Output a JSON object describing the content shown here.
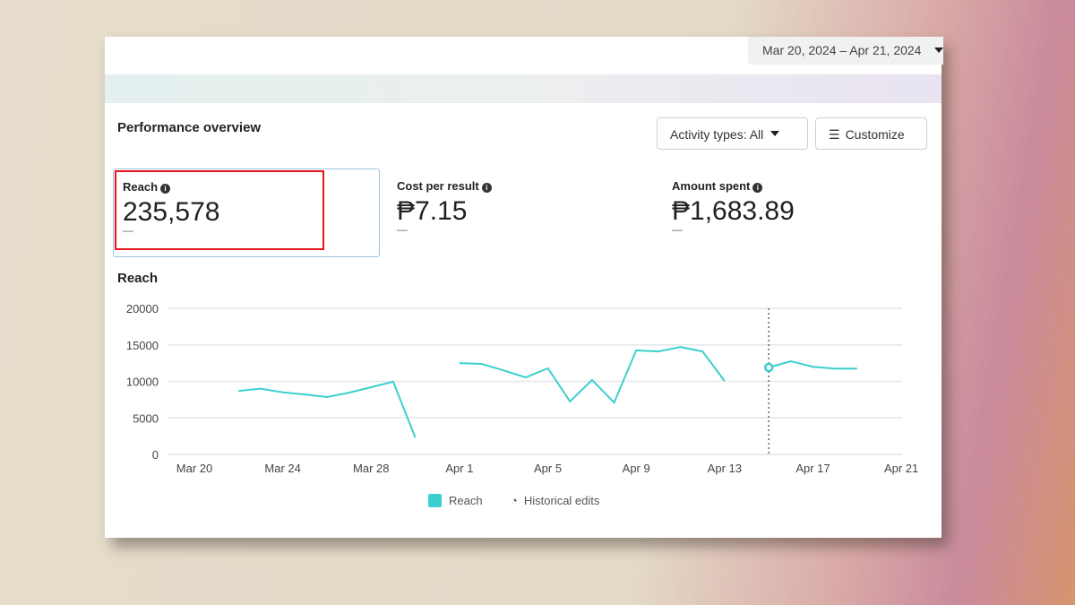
{
  "header": {
    "date_range": "Mar 20, 2024 – Apr 21, 2024"
  },
  "overview": {
    "title": "Performance overview",
    "activity_label": "Activity types: All",
    "customize_label": "Customize"
  },
  "metrics": [
    {
      "label": "Reach",
      "value": "235,578",
      "delta": "—"
    },
    {
      "label": "Cost per result",
      "value": "₱7.15",
      "delta": "—"
    },
    {
      "label": "Amount spent",
      "value": "₱1,683.89",
      "delta": "—"
    }
  ],
  "chart_data": {
    "type": "line",
    "title": "Reach",
    "ylim": [
      0,
      20000
    ],
    "yticks": [
      "0",
      "5000",
      "10000",
      "15000",
      "20000"
    ],
    "xticks": [
      "Mar 20",
      "Mar 24",
      "Mar 28",
      "Apr 1",
      "Apr 5",
      "Apr 9",
      "Apr 13",
      "Apr 17",
      "Apr 21"
    ],
    "x_start": "Mar 20",
    "series": [
      {
        "name": "Reach",
        "color": "#3ccfcf",
        "segments": [
          {
            "start_day": 2,
            "values": [
              8700,
              9000,
              8500,
              8200,
              7850,
              8450,
              9200,
              9950,
              2300
            ]
          },
          {
            "start_day": 12,
            "values": [
              12500,
              12400,
              11500,
              10550,
              11800,
              7250,
              10200,
              7100,
              14250,
              14100,
              14700,
              14100,
              10050
            ]
          },
          {
            "start_day": 26,
            "values": [
              11900,
              12750,
              12000,
              11750,
              11750
            ]
          }
        ]
      }
    ],
    "historical_edit_day": 26,
    "legend": [
      "Reach",
      "Historical edits"
    ]
  }
}
